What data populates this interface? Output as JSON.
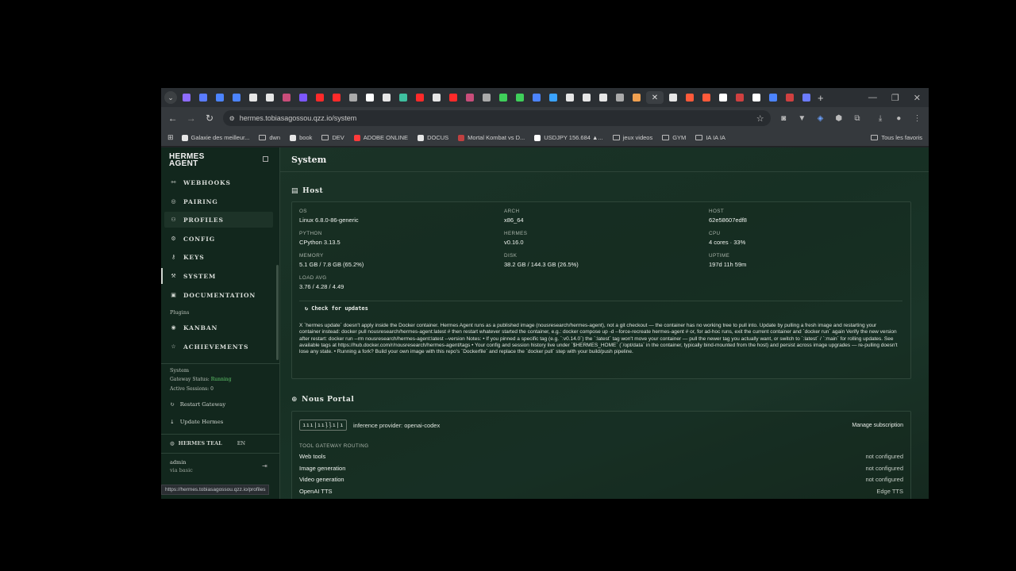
{
  "browser": {
    "url": "hermes.tobiasagossou.qzz.io/system",
    "bookmarks": [
      "Galaxie des meilleur...",
      "dwn",
      "book",
      "DEV",
      "ADOBE ONLINE",
      "DOCUS",
      "Mortal Kombat vs D...",
      "USDJPY 156.684 ▲...",
      "jeux videos",
      "GYM",
      "IA IA IA"
    ],
    "bookmarks_right": "Tous les favoris",
    "tab_colors": [
      "#8e6cff",
      "#5a7cff",
      "#4c84ff",
      "#4c84ff",
      "#e6e6e6",
      "#e6e6e6",
      "#c94d7a",
      "#7c57ff",
      "#ff2a2a",
      "#ff2a2a",
      "#aaaaaa",
      "#ffffff",
      "#e6e6e6",
      "#3fbf9f",
      "#ff2a2a",
      "#e6e6e6",
      "#ff2a2a",
      "#c94d7a",
      "#aaaaaa",
      "#3fcf5a",
      "#3fcf5a",
      "#4c84ff",
      "#3aa3ff",
      "#e6e6e6",
      "#e6e6e6",
      "#e6e6e6",
      "#aaaaaa",
      "#f0a050",
      "#e6e6e6",
      "#ff5a3a",
      "#ff5a3a",
      "#ffffff",
      "#d04040",
      "#ffffff",
      "#4c84ff",
      "#d04040",
      "#6c7cff"
    ]
  },
  "sidebar": {
    "brand_line1": "HERMES",
    "brand_line2": "AGENT",
    "nav": [
      {
        "label": "WEBHOOKS",
        "icon": "⚯"
      },
      {
        "label": "PAIRING",
        "icon": "◎"
      },
      {
        "label": "PROFILES",
        "icon": "⚇"
      },
      {
        "label": "CONFIG",
        "icon": "⚙"
      },
      {
        "label": "KEYS",
        "icon": "⚷"
      },
      {
        "label": "SYSTEM",
        "icon": "⚒"
      },
      {
        "label": "DOCUMENTATION",
        "icon": "▣"
      }
    ],
    "plugins_label": "Plugins",
    "plugins": [
      {
        "label": "KANBAN",
        "icon": "◉"
      },
      {
        "label": "ACHIEVEMENTS",
        "icon": "☆"
      }
    ],
    "system_label": "System",
    "gateway_status_label": "Gateway Status:",
    "gateway_status_value": "Running",
    "active_sessions": "Active Sessions: 0",
    "restart_label": "Restart Gateway",
    "update_label": "Update Hermes",
    "theme_label": "HERMES TEAL",
    "lang": "EN",
    "user_name": "admin",
    "user_auth": "via basic",
    "status_url": "https://hermes.tobiasagossou.qzz.io/profiles"
  },
  "main": {
    "title": "System",
    "host_title": "Host",
    "host": [
      {
        "key": "OS",
        "value": "Linux 6.8.0-86-generic"
      },
      {
        "key": "ARCH",
        "value": "x86_64"
      },
      {
        "key": "HOST",
        "value": "62e58607edf8"
      },
      {
        "key": "PYTHON",
        "value": "CPython 3.13.5"
      },
      {
        "key": "HERMES",
        "value": "v0.16.0"
      },
      {
        "key": "CPU",
        "value": "4 cores · 33%"
      },
      {
        "key": "MEMORY",
        "value": "5.1 GB / 7.8 GB (65.2%)"
      },
      {
        "key": "DISK",
        "value": "38.2 GB / 144.3 GB (26.5%)"
      },
      {
        "key": "UPTIME",
        "value": "197d 11h 59m"
      },
      {
        "key": "LOAD AVG",
        "value": "3.76 / 4.28 / 4.49"
      }
    ],
    "check_updates": "Check for updates",
    "update_notice": "X `hermes update` doesn't apply inside the Docker container. Hermes Agent runs as a published image (nousresearch/hermes-agent), not a git checkout — the container has no working tree to pull into. Update by pulling a fresh image and restarting your container instead: docker pull nousresearch/hermes-agent:latest # then restart whatever started the container, e.g.: docker compose up -d --force-recreate hermes-agent # or, for ad-hoc runs, exit the current container and `docker run` again Verify the new version after restart: docker run --rm nousresearch/hermes-agent:latest --version Notes: • If you pinned a specific tag (e.g. `:v0.14.0`) the `:latest` tag won't move your container — pull the newer tag you actually want, or switch to `:latest` / `:main` for rolling updates. See available tags at https://hub.docker.com/r/nousresearch/hermes-agent/tags • Your config and session history live under `$HERMES_HOME` (`/opt/data` in the container, typically bind-mounted from the host) and persist across image upgrades — re-pulling doesn't lose any state. • Running a fork? Build your own image with this repo's `Dockerfile` and replace the `docker pull` step with your build/push pipeline.",
    "nous_title": "Nous Portal",
    "nous_badge": "ııı|ııļļı|ı",
    "inference": "inference provider: openai-codex",
    "manage": "Manage subscription",
    "routing_label": "TOOL GATEWAY ROUTING",
    "routing": [
      {
        "name": "Web tools",
        "status": "not configured"
      },
      {
        "name": "Image generation",
        "status": "not configured"
      },
      {
        "name": "Video generation",
        "status": "not configured"
      },
      {
        "name": "OpenAI TTS",
        "status": "Edge TTS"
      }
    ]
  }
}
